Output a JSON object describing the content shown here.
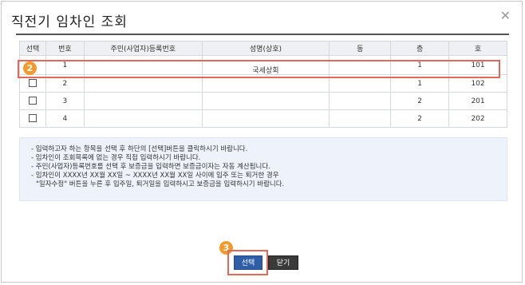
{
  "dialog": {
    "title": "직전기 임차인 조회",
    "close_glyph": "✕"
  },
  "table": {
    "headers": [
      "선택",
      "번호",
      "주민(사업자)등록번호",
      "성명(상호)",
      "동",
      "층",
      "호"
    ],
    "rows": [
      {
        "no": "1",
        "reg_no": "",
        "name": "국세상회",
        "dong": "",
        "floor": "1",
        "ho": "101"
      },
      {
        "no": "2",
        "reg_no": "",
        "name": "",
        "dong": "",
        "floor": "1",
        "ho": "102"
      },
      {
        "no": "3",
        "reg_no": "",
        "name": "",
        "dong": "",
        "floor": "2",
        "ho": "201"
      },
      {
        "no": "4",
        "reg_no": "",
        "name": "",
        "dong": "",
        "floor": "2",
        "ho": "202"
      }
    ]
  },
  "notice": {
    "lines": [
      "- 입력하고자 하는 항목을 선택 후 하단의 [선택]버튼을 클릭하시기 바랍니다.",
      "- 임차인이 조회목록에 없는 경우 직접 입력하시기 바랍니다.",
      "- 주민(사업자)등록번호를 선택 후 보증금을 입력하면 보증금이자는 자동 계산됩니다.",
      "- 임차인이 XXXX년 XX월 XX일 ~ XXXX년 XX월 XX일 사이에 입주 또는 퇴거한 경우",
      "  \"일자수정\" 버튼을 누른 후 입주일, 퇴거일을 입력하시고 보증금을 입력하시기 바랍니다."
    ]
  },
  "buttons": {
    "select_label": "선택",
    "close_label": "닫기"
  },
  "annotations": {
    "badge_row": "2",
    "badge_button": "3",
    "highlight_color": "#e06a5a",
    "badge_color": "#f39a2c"
  }
}
